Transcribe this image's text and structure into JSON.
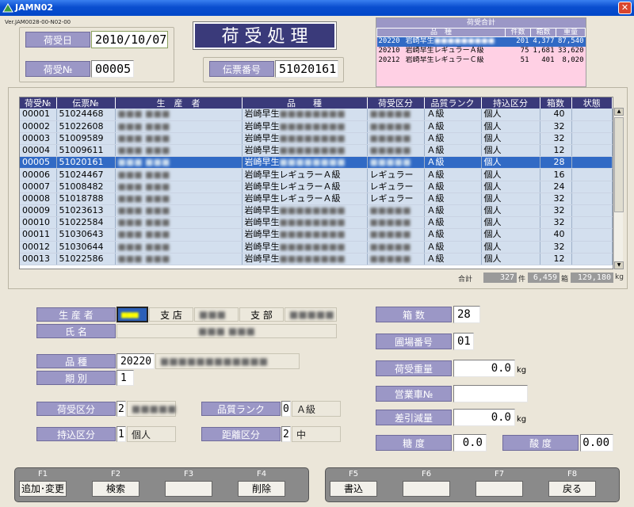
{
  "window": {
    "title": "JAMN02",
    "close_label": "✕"
  },
  "version": "Ver.JAM0028-00-N02-00",
  "form_title": "荷 受 処 理",
  "header": {
    "nyukabi_label": "荷受日",
    "nyukabi_value": "2010/10/07",
    "nyukano_label": "荷受№",
    "nyukano_value": "00005",
    "denpyo_label": "伝票番号",
    "denpyo_value": "51020161"
  },
  "summary": {
    "title": "荷受合計",
    "headers": [
      "品　種",
      "件数",
      "箱数",
      "重量"
    ],
    "rows": [
      {
        "code": "20220",
        "name": "岩崎早生",
        "name_blur": "■■■■■■■■■",
        "count": "201",
        "boxes": "4,377",
        "weight": "87,540"
      },
      {
        "code": "20210",
        "name": "岩崎早生レギュラーＡ級",
        "name_blur": "",
        "count": "75",
        "boxes": "1,681",
        "weight": "33,620"
      },
      {
        "code": "20212",
        "name": "岩崎早生レギュラーＣ級",
        "name_blur": "",
        "count": "51",
        "boxes": "401",
        "weight": "8,020"
      }
    ]
  },
  "grid": {
    "headers": [
      "荷受№",
      "伝票№",
      "生　産　者",
      "品　　種",
      "荷受区分",
      "品質ランク",
      "持込区分",
      "箱数",
      "状態"
    ],
    "rows": [
      {
        "no": "00001",
        "slip": "51024468",
        "producer": "■■■ ■■■",
        "variety": "岩崎早生",
        "variety_blur": "■■■■■■■■",
        "kubun": "■■■■■",
        "rank": "Ａ級",
        "mochikomi": "個人",
        "boxes": "40",
        "status": ""
      },
      {
        "no": "00002",
        "slip": "51022608",
        "producer": "■■■ ■■■",
        "variety": "岩崎早生",
        "variety_blur": "■■■■■■■■",
        "kubun": "■■■■■",
        "rank": "Ａ級",
        "mochikomi": "個人",
        "boxes": "32",
        "status": ""
      },
      {
        "no": "00003",
        "slip": "51009589",
        "producer": "■■■ ■■■",
        "variety": "岩崎早生",
        "variety_blur": "■■■■■■■■",
        "kubun": "■■■■■",
        "rank": "Ａ級",
        "mochikomi": "個人",
        "boxes": "32",
        "status": ""
      },
      {
        "no": "00004",
        "slip": "51009611",
        "producer": "■■■ ■■■",
        "variety": "岩崎早生",
        "variety_blur": "■■■■■■■■",
        "kubun": "■■■■■",
        "rank": "Ａ級",
        "mochikomi": "個人",
        "boxes": "12",
        "status": ""
      },
      {
        "no": "00005",
        "slip": "51020161",
        "producer": "■■■ ■■■",
        "variety": "岩崎早生",
        "variety_blur": "■■■■■■■■",
        "kubun": "■■■■■",
        "rank": "Ａ級",
        "mochikomi": "個人",
        "boxes": "28",
        "status": "",
        "selected": true
      },
      {
        "no": "00006",
        "slip": "51024467",
        "producer": "■■■ ■■■",
        "variety": "岩崎早生レギュラーＡ級",
        "variety_blur": "",
        "kubun": "レギュラー",
        "rank": "Ａ級",
        "mochikomi": "個人",
        "boxes": "16",
        "status": ""
      },
      {
        "no": "00007",
        "slip": "51008482",
        "producer": "■■■ ■■■",
        "variety": "岩崎早生レギュラーＡ級",
        "variety_blur": "",
        "kubun": "レギュラー",
        "rank": "Ａ級",
        "mochikomi": "個人",
        "boxes": "24",
        "status": ""
      },
      {
        "no": "00008",
        "slip": "51018788",
        "producer": "■■■ ■■■",
        "variety": "岩崎早生レギュラーＡ級",
        "variety_blur": "",
        "kubun": "レギュラー",
        "rank": "Ａ級",
        "mochikomi": "個人",
        "boxes": "32",
        "status": ""
      },
      {
        "no": "00009",
        "slip": "51023613",
        "producer": "■■■ ■■■",
        "variety": "岩崎早生",
        "variety_blur": "■■■■■■■■",
        "kubun": "■■■■■",
        "rank": "Ａ級",
        "mochikomi": "個人",
        "boxes": "32",
        "status": ""
      },
      {
        "no": "00010",
        "slip": "51022584",
        "producer": "■■■ ■■■",
        "variety": "岩崎早生",
        "variety_blur": "■■■■■■■■",
        "kubun": "■■■■■",
        "rank": "Ａ級",
        "mochikomi": "個人",
        "boxes": "32",
        "status": ""
      },
      {
        "no": "00011",
        "slip": "51030643",
        "producer": "■■■ ■■■",
        "variety": "岩崎早生",
        "variety_blur": "■■■■■■■■",
        "kubun": "■■■■■",
        "rank": "Ａ級",
        "mochikomi": "個人",
        "boxes": "40",
        "status": ""
      },
      {
        "no": "00012",
        "slip": "51030644",
        "producer": "■■■ ■■■",
        "variety": "岩崎早生",
        "variety_blur": "■■■■■■■■",
        "kubun": "■■■■■",
        "rank": "Ａ級",
        "mochikomi": "個人",
        "boxes": "32",
        "status": ""
      },
      {
        "no": "00013",
        "slip": "51022586",
        "producer": "■■■ ■■■",
        "variety": "岩崎早生",
        "variety_blur": "■■■■■■■■",
        "kubun": "■■■■■",
        "rank": "Ａ級",
        "mochikomi": "個人",
        "boxes": "12",
        "status": ""
      }
    ],
    "totals": {
      "label": "合計",
      "count": "327",
      "count_unit": "件",
      "boxes": "6,459",
      "boxes_unit": "箱",
      "weight": "129,180",
      "weight_unit": "kg"
    }
  },
  "detail": {
    "seisansha_label": "生 産 者",
    "seisansha_code": "■■■",
    "shiten_label": "支 店",
    "shiten_value": "■■■",
    "shibu_label": "支 部",
    "shibu_value": "■■■■■",
    "shimei_label": "氏 名",
    "shimei_value": "■■■ ■■■",
    "hinshu_label": "品 種",
    "hinshu_code": "20220",
    "hinshu_name": "■■■■■■■■■■■■",
    "kibetsu_label": "期 別",
    "kibetsu_value": "1",
    "nyukakubun_label": "荷受区分",
    "nyukakubun_code": "2",
    "nyukakubun_name": "■■■■■",
    "hinshitsu_label": "品質ランク",
    "hinshitsu_code": "0",
    "hinshitsu_name": "Ａ級",
    "mochikomi_label": "持込区分",
    "mochikomi_code": "1",
    "mochikomi_name": "個人",
    "kyori_label": "距離区分",
    "kyori_code": "2",
    "kyori_name": "中",
    "hakosu_label": "箱 数",
    "hakosu_value": "28",
    "enjo_label": "圃場番号",
    "enjo_value": "01",
    "juryo_label": "荷受重量",
    "juryo_value": "0.0",
    "juryo_unit": "kg",
    "eigyo_label": "営業車№",
    "eigyo_value": "",
    "genryo_label": "差引減量",
    "genryo_value": "0.0",
    "genryo_unit": "kg",
    "toudo_label": "糖 度",
    "toudo_value": "0.0",
    "sando_label": "酸 度",
    "sando_value": "0.00"
  },
  "fkeys": [
    {
      "key": "F1",
      "label": "追加･変更"
    },
    {
      "key": "F2",
      "label": "検索"
    },
    {
      "key": "F3",
      "label": ""
    },
    {
      "key": "F4",
      "label": "削除"
    },
    {
      "key": "F5",
      "label": "書込"
    },
    {
      "key": "F6",
      "label": ""
    },
    {
      "key": "F7",
      "label": ""
    },
    {
      "key": "F8",
      "label": "戻る"
    }
  ]
}
